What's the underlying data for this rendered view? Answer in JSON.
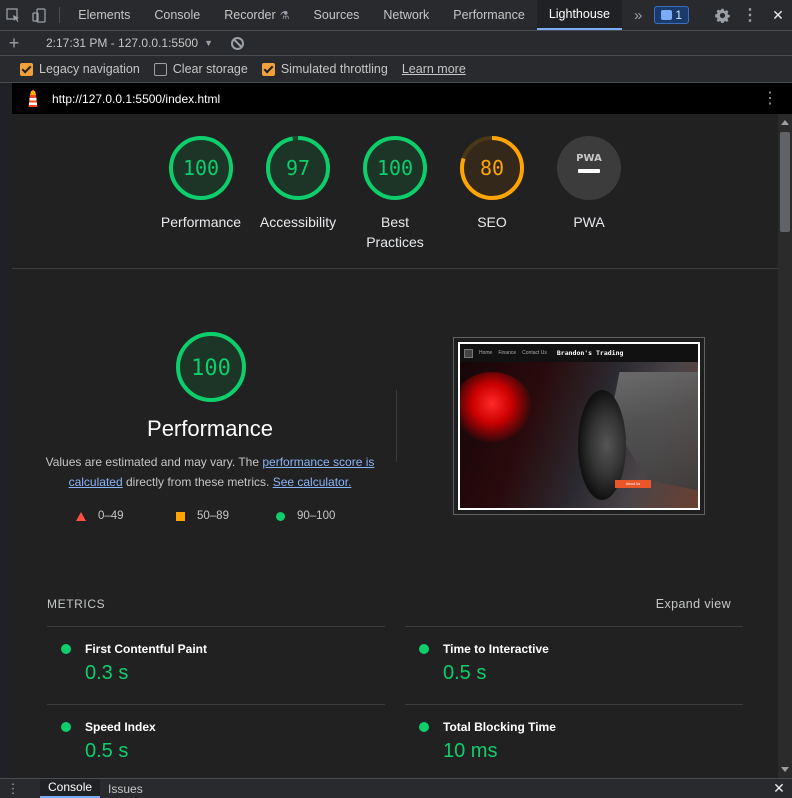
{
  "tabbar": {
    "tabs": [
      "Elements",
      "Console",
      "Recorder",
      "Sources",
      "Network",
      "Performance",
      "Lighthouse"
    ],
    "active_tab": "Lighthouse",
    "more": "»",
    "issues_count": "1",
    "close": "✕"
  },
  "reportbar": {
    "add": "+",
    "selected_report": "2:17:31 PM - 127.0.0.1:5500"
  },
  "options": {
    "legacy_navigation": "Legacy navigation",
    "clear_storage": "Clear storage",
    "simulated_throttling": "Simulated throttling",
    "learn_more": "Learn more",
    "legacy_checked": true,
    "clear_checked": false,
    "throttling_checked": true
  },
  "url": "http://127.0.0.1:5500/index.html",
  "categories": [
    {
      "label": "Performance",
      "score": "100",
      "value": 1.0,
      "color": "#0cce6b"
    },
    {
      "label": "Accessibility",
      "score": "97",
      "value": 0.97,
      "color": "#0cce6b"
    },
    {
      "label_line1": "Best",
      "label_line2": "Practices",
      "score": "100",
      "value": 1.0,
      "color": "#0cce6b"
    },
    {
      "label": "SEO",
      "score": "80",
      "value": 0.8,
      "color": "#ffa400"
    },
    {
      "label": "PWA",
      "badge": "PWA",
      "color": "#9aa0a6"
    }
  ],
  "performance": {
    "score": "100",
    "title": "Performance",
    "desc_1": "Values are estimated and may vary. The ",
    "link_1": "performance score is calculated",
    "desc_2": " directly from these metrics. ",
    "link_2": "See calculator.",
    "legend": [
      "0–49",
      "50–89",
      "90–100"
    ]
  },
  "screenshot": {
    "brand": "Brandon's Trading",
    "nav": [
      "Home",
      "Finance",
      "Contact Us"
    ],
    "button": "About Us"
  },
  "metrics": {
    "heading": "METRICS",
    "expand": "Expand view",
    "items": [
      {
        "name": "First Contentful Paint",
        "value": "0.3 s"
      },
      {
        "name": "Time to Interactive",
        "value": "0.5 s"
      },
      {
        "name": "Speed Index",
        "value": "0.5 s"
      },
      {
        "name": "Total Blocking Time",
        "value": "10 ms"
      }
    ]
  },
  "drawer": {
    "tabs": [
      "Console",
      "Issues"
    ],
    "close": "✕"
  },
  "colors": {
    "pass": "#0cce6b",
    "average": "#ffa400",
    "fail": "#ff4e42",
    "accent": "#7cacf8"
  }
}
